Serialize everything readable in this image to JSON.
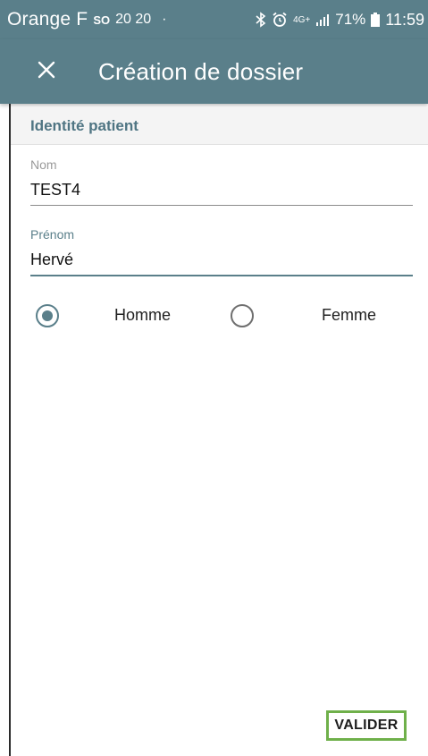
{
  "status_bar": {
    "carrier": "Orange F",
    "so_badge": "SO",
    "notif_numbers": "20 20",
    "dot": "·",
    "network": "4G+",
    "battery": "71%",
    "time": "11:59"
  },
  "app_bar": {
    "title": "Création de dossier",
    "close_icon": "close-icon"
  },
  "section": {
    "title": "Identité patient"
  },
  "fields": {
    "nom": {
      "label": "Nom",
      "value": "TEST4"
    },
    "prenom": {
      "label": "Prénom",
      "value": "Hervé"
    }
  },
  "gender": {
    "options": [
      {
        "label": "Homme",
        "selected": true
      },
      {
        "label": "Femme",
        "selected": false
      }
    ]
  },
  "actions": {
    "valider_label": "VALIDER"
  },
  "colors": {
    "primary": "#5a7f8a",
    "highlight": "#6fb04a"
  }
}
